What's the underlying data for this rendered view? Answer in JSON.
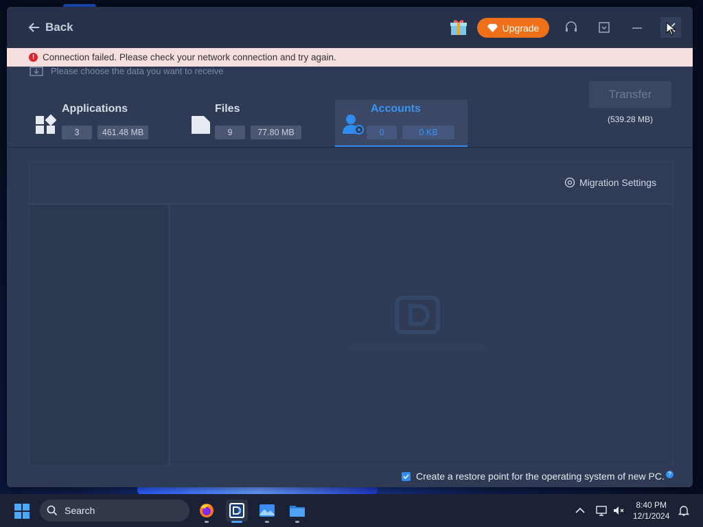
{
  "titlebar": {
    "back_label": "Back",
    "upgrade_label": "Upgrade"
  },
  "error": {
    "message": "Connection failed. Please check your network connection and try again."
  },
  "instruction": "Please choose the data you want to receive",
  "categories": [
    {
      "title": "Applications",
      "count": "3",
      "size": "461.48 MB",
      "icon": "apps-icon",
      "active": false
    },
    {
      "title": "Files",
      "count": "9",
      "size": "77.80 MB",
      "icon": "file-icon",
      "active": false
    },
    {
      "title": "Accounts",
      "count": "0",
      "size": "0 KB",
      "icon": "account-icon",
      "active": true
    }
  ],
  "transfer": {
    "label": "Transfer",
    "total_size": "(539.28 MB)"
  },
  "migration_settings_label": "Migration Settings",
  "restore_point_label": "Create a restore point for the operating system of new PC.",
  "restore_checked": true,
  "taskbar": {
    "search_placeholder": "Search",
    "time": "8:40 PM",
    "date": "12/1/2024",
    "apps": [
      "firefox-icon",
      "easeus-todo-pctrans-icon",
      "photos-icon",
      "file-explorer-icon"
    ]
  },
  "colors": {
    "accent": "#2f8cf0",
    "upgrade": "#f07019",
    "error_bg": "#f6dede",
    "error_icon": "#e0232b",
    "window_bg": "#2f3b55"
  }
}
